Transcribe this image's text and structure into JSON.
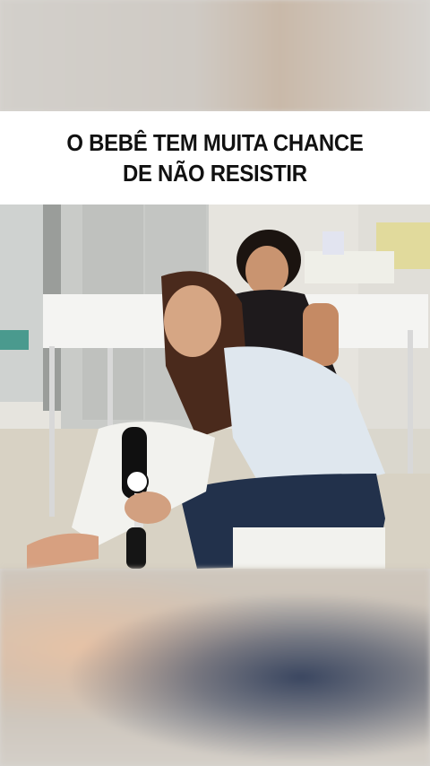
{
  "caption": {
    "line1": "O BEBÊ TEM MUITA CHANCE",
    "line2": "DE NÃO RESISTIR"
  },
  "colors": {
    "caption_bg": "#ffffff",
    "caption_text": "#111111"
  }
}
